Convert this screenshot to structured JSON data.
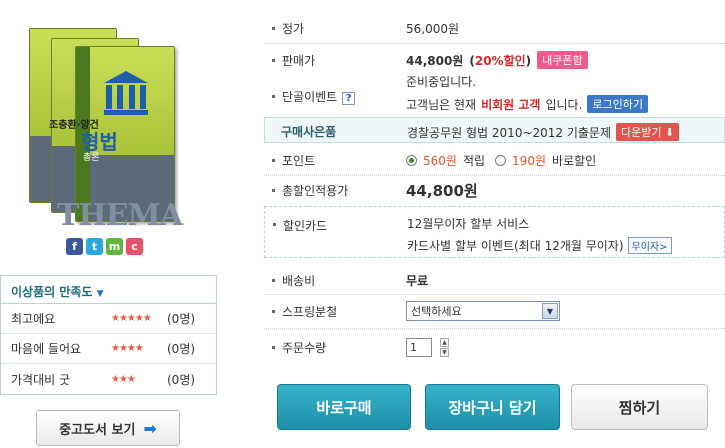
{
  "cover": {
    "author": "조충환·양건",
    "title": "형법",
    "subtitle": "총론",
    "brand": "테마",
    "series_text": "THEMA"
  },
  "social": [
    "f",
    "t",
    "m",
    "c"
  ],
  "satisfaction": {
    "title": "이상품의 만족도",
    "rows": [
      {
        "label": "최고에요",
        "stars": 5,
        "count": "(0명)"
      },
      {
        "label": "마음에 들어요",
        "stars": 4,
        "count": "(0명)"
      },
      {
        "label": "가격대비 굿",
        "stars": 3,
        "count": "(0명)"
      }
    ]
  },
  "used_book_button": "중고도서 보기",
  "product": {
    "list_price_label": "정가",
    "list_price": "56,000원",
    "sale_price_label": "판매가",
    "sale_price": "44,800원",
    "discount_open": "(",
    "discount": "20%할인",
    "discount_close": ")",
    "coupon_badge": "내쿠폰함",
    "event_label": "단골이벤트",
    "event_line1": "준비중입니다.",
    "event_line2_pre": "고객님은 현재",
    "event_status": "비회원 고객",
    "event_line2_post": "입니다.",
    "login_button": "로그인하기",
    "gift_label": "구매사은품",
    "gift_text": "경찰공무원 형법 2010~2012 기출문제",
    "gift_button": "다운받기",
    "point_label": "포인트",
    "point_opt1": "560원",
    "point_opt1_suffix": "적립",
    "point_opt2": "190원",
    "point_opt2_suffix": "바로할인",
    "total_label": "총할인적용가",
    "total": "44,800원",
    "card_label": "할인카드",
    "card_line1": "12월무이자 할부 서비스",
    "card_line2": "카드사별 할부 이벤트(최대 12개월 무이자)",
    "card_button": "무이자",
    "shipping_label": "배송비",
    "shipping": "무료",
    "spring_label": "스프링분철",
    "spring_select": "선택하세요",
    "qty_label": "주문수량",
    "qty": "1"
  },
  "actions": {
    "buy": "바로구매",
    "cart": "장바구니 담기",
    "wish": "찜하기"
  },
  "colors": {
    "accent": "#1e8fa9",
    "price_red": "#d3292a",
    "pink": "#f05b8c"
  }
}
